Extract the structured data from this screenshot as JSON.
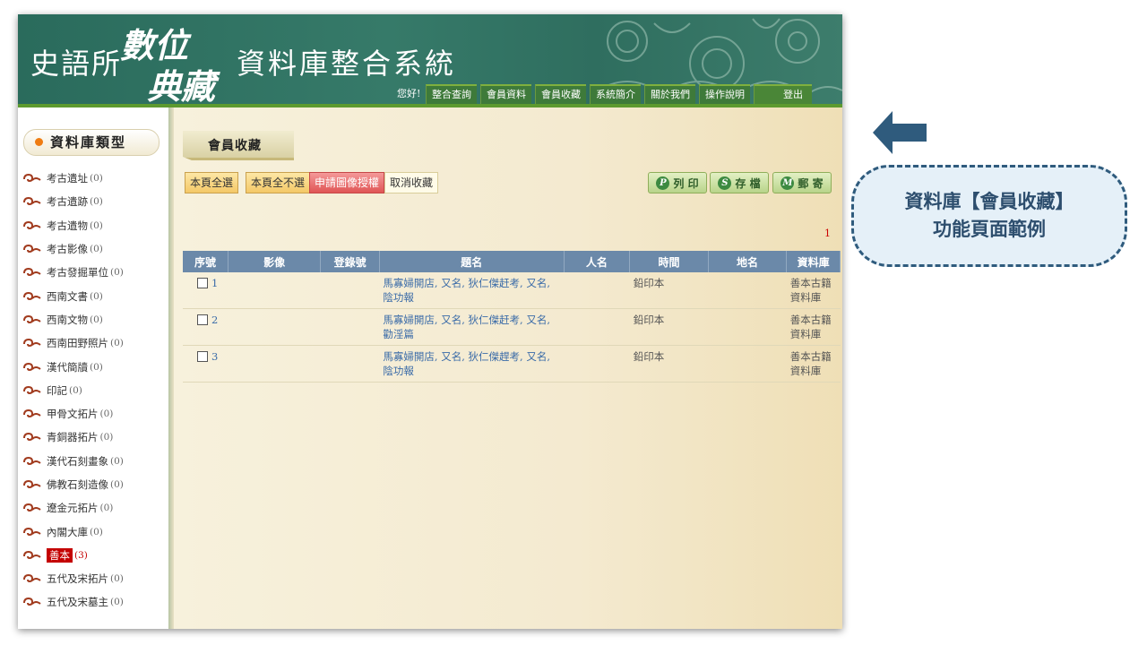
{
  "header": {
    "logo_left": "史語所",
    "logo_mid_top": "數位",
    "logo_mid_bottom": "典藏",
    "logo_right": "資料庫整合系統",
    "greeting": "您好!",
    "nav": [
      "整合查詢",
      "會員資料",
      "會員收藏",
      "系統簡介",
      "關於我們",
      "操作說明"
    ],
    "logout": "登出"
  },
  "sidebar": {
    "title": "資料庫類型",
    "items": [
      {
        "label": "考古遺址",
        "count": "(0)"
      },
      {
        "label": "考古遺跡",
        "count": "(0)"
      },
      {
        "label": "考古遺物",
        "count": "(0)"
      },
      {
        "label": "考古影像",
        "count": "(0)"
      },
      {
        "label": "考古發掘單位",
        "count": "(0)"
      },
      {
        "label": "西南文書",
        "count": "(0)"
      },
      {
        "label": "西南文物",
        "count": "(0)"
      },
      {
        "label": "西南田野照片",
        "count": "(0)"
      },
      {
        "label": "漢代簡牘",
        "count": "(0)"
      },
      {
        "label": "印記",
        "count": "(0)"
      },
      {
        "label": "甲骨文拓片",
        "count": "(0)"
      },
      {
        "label": "青銅器拓片",
        "count": "(0)"
      },
      {
        "label": "漢代石刻畫象",
        "count": "(0)"
      },
      {
        "label": "佛教石刻造像",
        "count": "(0)"
      },
      {
        "label": "遼金元拓片",
        "count": "(0)"
      },
      {
        "label": "內閣大庫",
        "count": "(0)"
      },
      {
        "label": "善本",
        "count": "(3)",
        "active": true
      },
      {
        "label": "五代及宋拓片",
        "count": "(0)"
      },
      {
        "label": "五代及宋墓主",
        "count": "(0)"
      }
    ]
  },
  "main": {
    "page_title": "會員收藏",
    "buttons": {
      "select_all": "本頁全選",
      "deselect_all": "本頁全不選",
      "request_auth": "申請圖像授權",
      "cancel_fav": "取消收藏"
    },
    "actions": {
      "print": "列 印",
      "save": "存 檔",
      "mail": "郵 寄"
    },
    "page_number": "1",
    "columns": [
      "序號",
      "影像",
      "登錄號",
      "題名",
      "人名",
      "時間",
      "地名",
      "資料庫"
    ],
    "rows": [
      {
        "seq": "1",
        "image": "",
        "reg": "",
        "title": "馬寡婦開店, 又名, 狄仁傑赶考, 又名, 陰功報",
        "person": "",
        "time": "鉛印本",
        "place": "",
        "db": "善本古籍資料庫"
      },
      {
        "seq": "2",
        "image": "",
        "reg": "",
        "title": "馬寡婦開店, 又名, 狄仁傑赶考, 又名, 勸淫篇",
        "person": "",
        "time": "鉛印本",
        "place": "",
        "db": "善本古籍資料庫"
      },
      {
        "seq": "3",
        "image": "",
        "reg": "",
        "title": "馬寡婦開店, 又名, 狄仁傑趕考, 又名, 陰功報",
        "person": "",
        "time": "鉛印本",
        "place": "",
        "db": "善本古籍資料庫"
      }
    ]
  },
  "annotation": {
    "line1": "資料庫【會員收藏】",
    "line2": "功能頁面範例"
  },
  "colors": {
    "header_green": "#2f6e5f",
    "nav_green": "#3e7a3a",
    "table_header": "#6b89a9",
    "active_red": "#c40000",
    "callout_border": "#2f5b7d",
    "arrow": "#2f5b7d"
  }
}
